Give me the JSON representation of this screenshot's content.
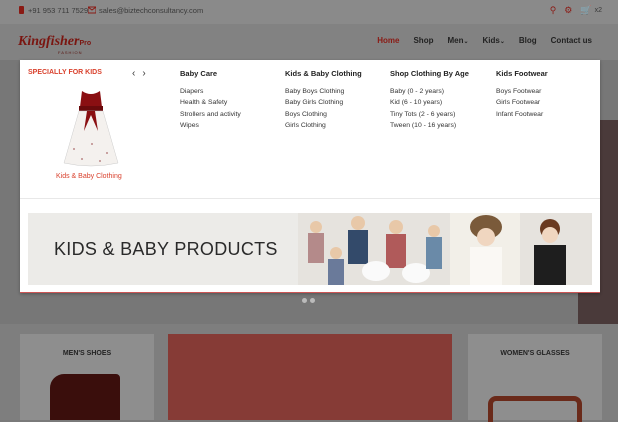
{
  "topbar": {
    "phone": "+91 953 711 7529",
    "email": "sales@biztechconsultancy.com",
    "cart_count": "x2"
  },
  "header": {
    "logo_name": "Kingfisher",
    "logo_pro": "Pro",
    "logo_sub": "FASHION",
    "nav": [
      "Home",
      "Shop",
      "Men",
      "Kids",
      "Blog",
      "Contact us"
    ]
  },
  "mega": {
    "special_title": "SPECIALLY FOR KIDS",
    "featured_label": "Kids & Baby Clothing",
    "columns": [
      {
        "heading": "Baby Care",
        "items": [
          "Diapers",
          "Health & Safety",
          "Strollers and activity",
          "Wipes"
        ]
      },
      {
        "heading": "Kids & Baby Clothing",
        "items": [
          "Baby Boys Clothing",
          "Baby Girls Clothing",
          "Boys Clothing",
          "Girls Clothing"
        ]
      },
      {
        "heading": "Shop Clothing By Age",
        "items": [
          "Baby (0 - 2 years)",
          "Kid (6 - 10 years)",
          "Tiny Tots (2 - 6 years)",
          "Tween (10 - 16 years)"
        ]
      },
      {
        "heading": "Kids Footwear",
        "items": [
          "Boys Footwear",
          "Girls Footwear",
          "Infant Footwear"
        ]
      }
    ],
    "banner_text": "KIDS & BABY PRODUCTS"
  },
  "panels": {
    "left_title": "MEN'S SHOES",
    "right_title": "WOMEN'S GLASSES"
  },
  "colors": {
    "accent": "#d9412d",
    "brand": "#7a1510"
  }
}
